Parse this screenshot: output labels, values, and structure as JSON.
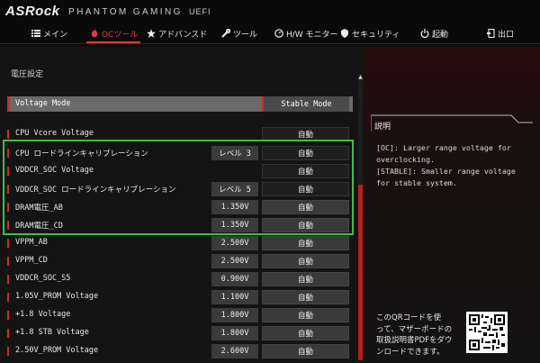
{
  "header": {
    "brand": "ASRock",
    "product": "PHANTOM GAMING",
    "product_suffix": "UEFI",
    "nav": [
      {
        "label": "メイン",
        "icon": "list-icon"
      },
      {
        "label": "OCツール",
        "icon": "flame-icon",
        "active": true
      },
      {
        "label": "アドバンスド",
        "icon": "star-icon"
      },
      {
        "label": "ツール",
        "icon": "wrench-icon"
      },
      {
        "label": "H/W モニター",
        "icon": "monitor-icon"
      },
      {
        "label": "セキュリティ",
        "icon": "shield-icon"
      },
      {
        "label": "起動",
        "icon": "power-icon"
      },
      {
        "label": "出口",
        "icon": "exit-icon"
      }
    ]
  },
  "section_title": "電圧設定",
  "voltage_mode": {
    "label": "Voltage Mode",
    "value": "Stable Mode"
  },
  "rows": [
    {
      "label": "CPU Vcore Voltage",
      "value": "",
      "setting": "自動",
      "dim": false
    },
    {
      "label": "CPU ロードラインキャリブレーション",
      "value": "レベル 3",
      "setting": "自動",
      "dim": false
    },
    {
      "label": "VDDCR_SOC Voltage",
      "value": "",
      "setting": "自動",
      "dim": false
    },
    {
      "label": "VDDCR_SOC ロードラインキャリブレーション",
      "value": "レベル 5",
      "setting": "自動",
      "dim": false
    },
    {
      "label": "DRAM電圧_AB",
      "value": "1.350V",
      "setting": "自動",
      "dim": true
    },
    {
      "label": "DRAM電圧_CD",
      "value": "1.350V",
      "setting": "自動",
      "dim": true
    },
    {
      "label": "VPPM_AB",
      "value": "2.500V",
      "setting": "自動",
      "dim": true
    },
    {
      "label": "VPPM_CD",
      "value": "2.500V",
      "setting": "自動",
      "dim": true
    },
    {
      "label": "VDDCR_SOC_S5",
      "value": "0.900V",
      "setting": "自動",
      "dim": true
    },
    {
      "label": "1.05V_PROM Voltage",
      "value": "1.100V",
      "setting": "自動",
      "dim": true
    },
    {
      "label": "+1.8 Voltage",
      "value": "1.800V",
      "setting": "自動",
      "dim": true
    },
    {
      "label": "+1.8 STB Voltage",
      "value": "1.800V",
      "setting": "自動",
      "dim": true
    },
    {
      "label": "2.50V_PROM Voltage",
      "value": "2.600V",
      "setting": "自動",
      "dim": true
    }
  ],
  "description": {
    "title": "説明",
    "lines": [
      "[OC]: Larger range voltage for",
      "overclocking.",
      "[STABLE]: Smaller range voltage",
      "for stable system."
    ]
  },
  "qr_note": {
    "lines": [
      "このQRコードを使",
      "って、マザーボードの",
      "取扱説明書PDFをダウ",
      "ンロードできます。"
    ]
  },
  "colors": {
    "accent": "#d42828",
    "highlight": "#3bbf4a"
  }
}
